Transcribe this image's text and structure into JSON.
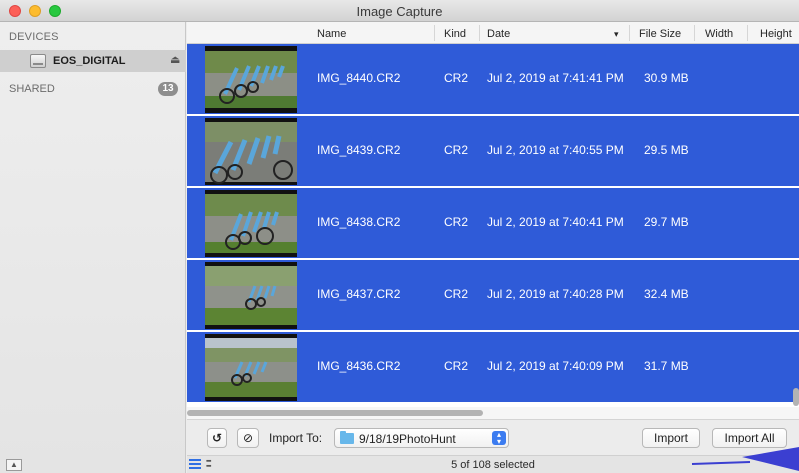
{
  "window": {
    "title": "Image Capture"
  },
  "sidebar": {
    "devices_header": "DEVICES",
    "device": {
      "label": "EOS_DIGITAL"
    },
    "shared_label": "SHARED",
    "shared_count": "13"
  },
  "columns": [
    "Name",
    "Kind",
    "Date",
    "File Size",
    "Width",
    "Height"
  ],
  "rows": [
    {
      "name": "IMG_8440.CR2",
      "kind": "CR2",
      "date": "Jul 2, 2019 at 7:41:41 PM",
      "size": "30.9 MB"
    },
    {
      "name": "IMG_8439.CR2",
      "kind": "CR2",
      "date": "Jul 2, 2019 at 7:40:55 PM",
      "size": "29.5 MB"
    },
    {
      "name": "IMG_8438.CR2",
      "kind": "CR2",
      "date": "Jul 2, 2019 at 7:40:41 PM",
      "size": "29.7 MB"
    },
    {
      "name": "IMG_8437.CR2",
      "kind": "CR2",
      "date": "Jul 2, 2019 at 7:40:28 PM",
      "size": "32.4 MB"
    },
    {
      "name": "IMG_8436.CR2",
      "kind": "CR2",
      "date": "Jul 2, 2019 at 7:40:09 PM",
      "size": "31.7 MB"
    }
  ],
  "import_bar": {
    "import_to_label": "Import To:",
    "destination": "9/18/19PhotoHunt",
    "import_button": "Import",
    "import_all_button": "Import All"
  },
  "status": {
    "selection_text": "5 of 108 selected"
  },
  "colors": {
    "selection": "#2f5bd8",
    "accent": "#2f6fe4",
    "annotation_arrow": "#3b3fd1"
  }
}
